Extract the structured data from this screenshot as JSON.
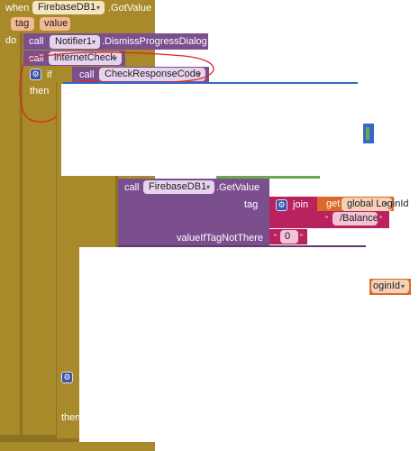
{
  "event": {
    "when_label": "when",
    "component": "FirebaseDB1",
    "event_name": ".GotValue",
    "param_tag": "tag",
    "param_value": "value",
    "do_label": "do"
  },
  "stmt1": {
    "call_label": "call",
    "component": "Notifier1",
    "method": ".DismissProgressDialog"
  },
  "stmt2": {
    "call_label": "call",
    "procedure": "internetCheck"
  },
  "if_block": {
    "if_label": "if",
    "then_label": "then",
    "condition": {
      "call_label": "call",
      "procedure": "CheckResponseCode"
    }
  },
  "getvalue": {
    "call_label": "call",
    "component": "FirebaseDB1",
    "method": ".GetValue",
    "tag_label": "tag",
    "join_label": "join",
    "get_label": "get",
    "global_var": "global LoginId",
    "balance_text": "/Balance",
    "value_if_label": "valueIfTagNotThere",
    "default_value": "0"
  },
  "fragment": {
    "login_chip": "oginId",
    "then_label2": "then"
  }
}
